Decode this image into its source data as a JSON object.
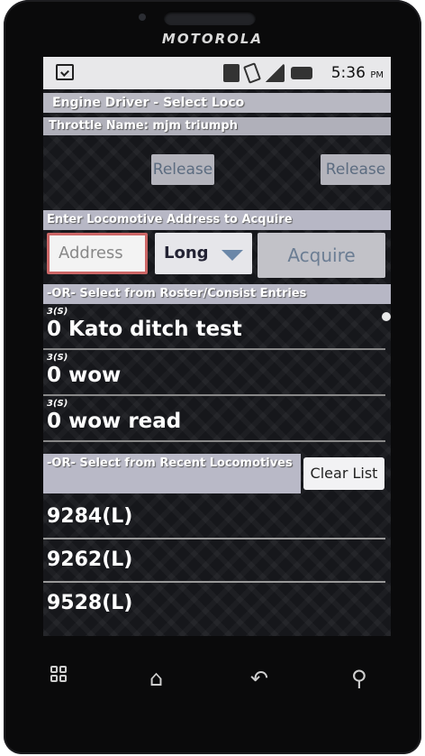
{
  "device": {
    "brand": "MOTOROLA"
  },
  "status_bar": {
    "time": "5:36",
    "ampm": "PM"
  },
  "app": {
    "title": "Engine Driver - Select Loco",
    "throttle_name": "Throttle Name: mjm triumph"
  },
  "release_buttons": [
    "Release",
    "Release"
  ],
  "acquire_section": {
    "header": "Enter Locomotive Address to Acquire",
    "address_placeholder": "Address",
    "address_type": "Long",
    "acquire_label": "Acquire"
  },
  "roster_section": {
    "header": "-OR- Select from Roster/Consist Entries",
    "items": [
      {
        "sub": "3(S)",
        "name": "0 Kato ditch test"
      },
      {
        "sub": "3(S)",
        "name": "0 wow"
      },
      {
        "sub": "3(S)",
        "name": "0 wow read"
      }
    ]
  },
  "recent_section": {
    "header": "-OR- Select from Recent Locomotives",
    "clear_label": "Clear List",
    "items": [
      "9284(L)",
      "9262(L)",
      "9528(L)"
    ]
  },
  "nav": [
    "apps-icon",
    "home-icon",
    "back-icon",
    "search-icon"
  ],
  "colors": {
    "header_bg": "#b7b7c5",
    "screen_bg": "#16171b",
    "status_bg": "#e8e8ea"
  }
}
